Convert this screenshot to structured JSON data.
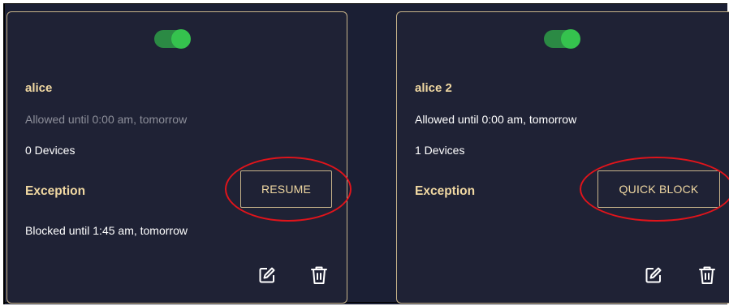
{
  "colors": {
    "background": "#1b1f34",
    "card_border": "#c8b48a",
    "accent_text": "#f0d8a2",
    "toggle_on": "#35c24e",
    "highlight_circle": "#e0141b"
  },
  "profiles": [
    {
      "name": "alice",
      "toggle_on": true,
      "allowed_text": "Allowed until 0:00 am, tomorrow",
      "devices_text": "0 Devices",
      "exception_label": "Exception",
      "action_label": "RESUME",
      "blocked_text": "Blocked until 1:45 am, tomorrow",
      "icons": {
        "edit": "edit-icon",
        "delete": "trash-icon"
      }
    },
    {
      "name": "alice 2",
      "toggle_on": true,
      "allowed_text": "Allowed until 0:00 am, tomorrow",
      "devices_text": "1 Devices",
      "exception_label": "Exception",
      "action_label": "QUICK BLOCK",
      "icons": {
        "edit": "edit-icon",
        "delete": "trash-icon"
      }
    }
  ]
}
